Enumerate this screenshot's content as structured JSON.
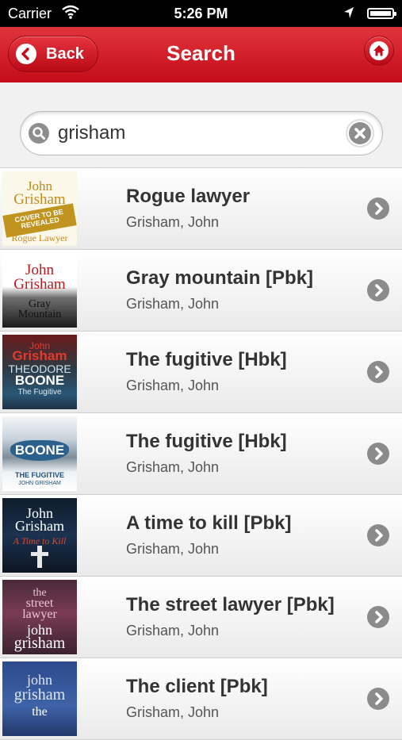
{
  "status_bar": {
    "carrier": "Carrier",
    "time": "5:26 PM"
  },
  "nav": {
    "back_label": "Back",
    "title": "Search"
  },
  "search": {
    "value": "grisham"
  },
  "books": [
    {
      "title": "Rogue lawyer",
      "author": "Grisham, John",
      "cover_lines": [
        "John",
        "Grisham",
        "COVER TO BE REVEALED",
        "Rogue Lawyer"
      ]
    },
    {
      "title": "Gray mountain [Pbk]",
      "author": "Grisham, John",
      "cover_lines": [
        "John",
        "Grisham",
        "Gray",
        "Mountain"
      ]
    },
    {
      "title": "The fugitive [Hbk]",
      "author": "Grisham, John",
      "cover_lines": [
        "John",
        "Grisham",
        "THEODORE",
        "BOONE",
        "The Fugitive"
      ]
    },
    {
      "title": "The fugitive [Hbk]",
      "author": "Grisham, John",
      "cover_lines": [
        "BOONE",
        "THE FUGITIVE",
        "JOHN GRISHAM"
      ]
    },
    {
      "title": "A time to kill [Pbk]",
      "author": "Grisham, John",
      "cover_lines": [
        "John",
        "Grisham",
        "A Time to Kill"
      ]
    },
    {
      "title": "The street lawyer [Pbk]",
      "author": "Grisham, John",
      "cover_lines": [
        "the",
        "street",
        "lawyer",
        "john",
        "grisham"
      ]
    },
    {
      "title": "The client [Pbk]",
      "author": "Grisham, John",
      "cover_lines": [
        "john",
        "grisham",
        "the"
      ]
    }
  ],
  "colors": {
    "nav_red": "#c40d19",
    "chevron_gray": "#8b8b8b"
  }
}
